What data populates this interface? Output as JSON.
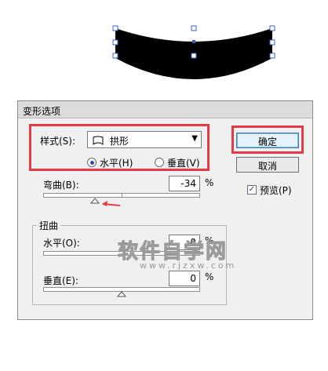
{
  "dialog": {
    "title": "变形选项",
    "style_label": "样式(S):",
    "style_value": "拱形",
    "orientation": {
      "horizontal_label": "水平(H)",
      "vertical_label": "垂直(V)",
      "selected": "horizontal"
    },
    "bend": {
      "label": "弯曲(B):",
      "value": "-34",
      "unit": "%",
      "slider_percent": -34
    },
    "distortion": {
      "group_label": "扭曲",
      "horizontal_label": "水平(O):",
      "horizontal_value": "0",
      "horizontal_unit": "%",
      "horizontal_slider_percent": 0,
      "vertical_label": "垂直(E):",
      "vertical_value": "0",
      "vertical_unit": "%",
      "vertical_slider_percent": 0
    },
    "buttons": {
      "ok": "确定",
      "cancel": "取消"
    },
    "preview": {
      "label": "预览(P)",
      "checked": true
    }
  },
  "watermark": {
    "text": "软件自学网",
    "sub": "www.rjzxw.com"
  },
  "colors": {
    "highlight": "#e63a46",
    "preview_fill": "#000000",
    "handle": "#3a5fcd"
  }
}
